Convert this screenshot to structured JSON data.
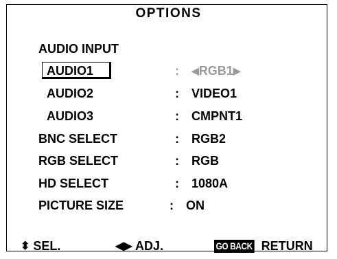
{
  "menu": {
    "title": "OPTIONS",
    "section_label": "AUDIO INPUT",
    "items": [
      {
        "label": "AUDIO1",
        "value": "RGB1",
        "selected": true
      },
      {
        "label": "AUDIO2",
        "value": "VIDEO1"
      },
      {
        "label": "AUDIO3",
        "value": "CMPNT1"
      },
      {
        "label": "BNC SELECT",
        "value": "RGB2"
      },
      {
        "label": "RGB SELECT",
        "value": "RGB"
      },
      {
        "label": "HD SELECT",
        "value": "1080A"
      },
      {
        "label": "PICTURE SIZE",
        "value": "ON"
      }
    ],
    "separator": ":"
  },
  "footer": {
    "select_label": "SEL.",
    "adjust_label": "ADJ.",
    "goback_label": "GO BACK",
    "return_label": "RETURN"
  },
  "icons": {
    "select": "up-down-arrow-icon",
    "adjust": "left-right-arrow-icon",
    "value_left": "left-arrow-icon",
    "value_right": "right-arrow-icon"
  },
  "colors": {
    "text": "#000000",
    "inactive_value": "#9a9a9a",
    "background": "#ffffff"
  }
}
